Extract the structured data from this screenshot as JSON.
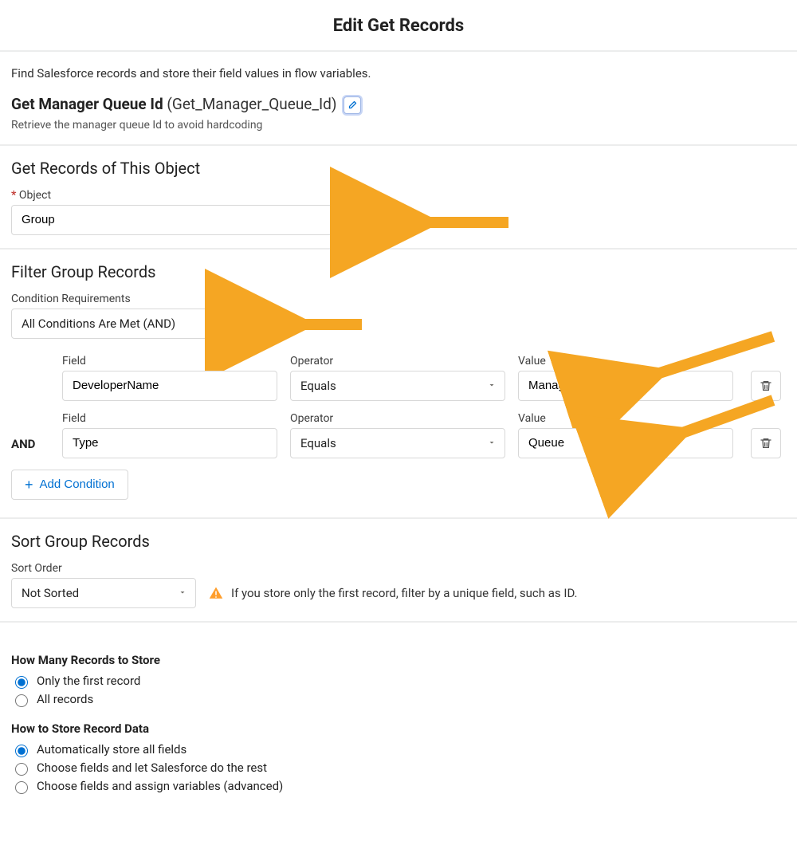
{
  "header": {
    "title": "Edit Get Records"
  },
  "intro": {
    "description": "Find Salesforce records and store their field values in flow variables.",
    "element_label": "Get Manager Queue Id",
    "element_api": "(Get_Manager_Queue_Id)",
    "help_text": "Retrieve the manager queue Id to avoid hardcoding"
  },
  "object_section": {
    "heading": "Get Records of This Object",
    "object_label": "Object",
    "object_value": "Group"
  },
  "filter_section": {
    "heading": "Filter Group Records",
    "cond_req_label": "Condition Requirements",
    "cond_req_value": "All Conditions Are Met (AND)",
    "field_label": "Field",
    "operator_label": "Operator",
    "value_label": "Value",
    "and_label": "AND",
    "add_condition_label": "Add Condition",
    "rows": [
      {
        "field": "DeveloperName",
        "operator": "Equals",
        "value": "Manager"
      },
      {
        "field": "Type",
        "operator": "Equals",
        "value": "Queue"
      }
    ]
  },
  "sort_section": {
    "heading": "Sort Group Records",
    "sort_order_label": "Sort Order",
    "sort_order_value": "Not Sorted",
    "warning_text": "If you store only the first record, filter by a unique field, such as ID."
  },
  "store_section": {
    "count_heading": "How Many Records to Store",
    "count_options": [
      "Only the first record",
      "All records"
    ],
    "count_selected": 0,
    "data_heading": "How to Store Record Data",
    "data_options": [
      "Automatically store all fields",
      "Choose fields and let Salesforce do the rest",
      "Choose fields and assign variables (advanced)"
    ],
    "data_selected": 0
  },
  "colors": {
    "arrow": "#f5a623",
    "link": "#0070d2",
    "warn": "#ff9e2c"
  }
}
